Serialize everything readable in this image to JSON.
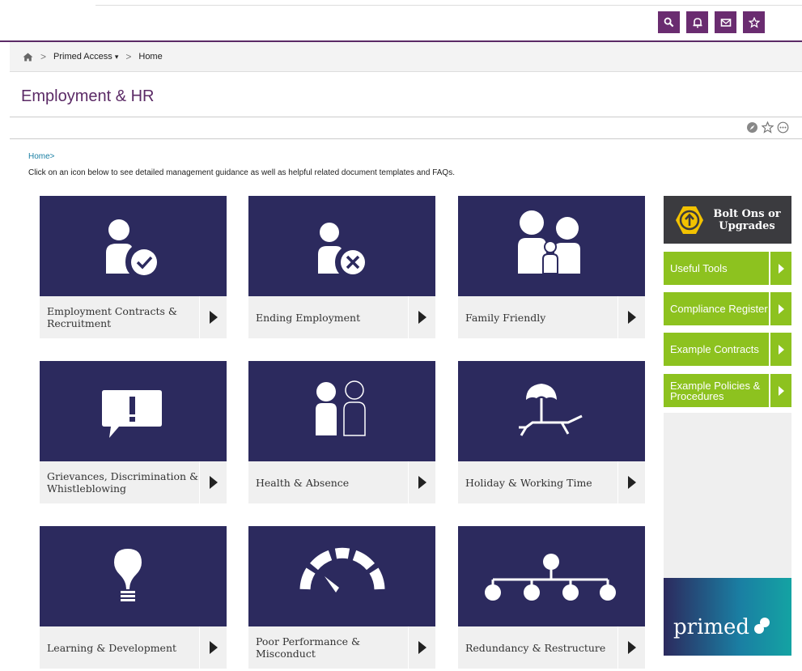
{
  "header": {
    "icons": [
      "search-icon",
      "bell-icon",
      "mail-icon",
      "star-icon"
    ]
  },
  "breadcrumb": {
    "home_icon": "home-icon",
    "items": [
      "Primed Access",
      "Home"
    ],
    "dropdown_caret": "▾",
    "separator": ">"
  },
  "page": {
    "title": "Employment & HR",
    "toolbar_icons": [
      "compass-icon",
      "star-outline-icon",
      "more-icon"
    ],
    "home_link": "Home>",
    "intro": "Click on an icon below to see detailed management guidance as well as helpful related document templates and FAQs."
  },
  "tiles": [
    {
      "label": "Employment Contracts & Recruitment",
      "icon": "person-check-icon"
    },
    {
      "label": "Ending Employment",
      "icon": "person-cross-icon"
    },
    {
      "label": "Family Friendly",
      "icon": "family-icon"
    },
    {
      "label": "Grievances, Discrimination & Whistleblowing",
      "icon": "speech-alert-icon"
    },
    {
      "label": "Health & Absence",
      "icon": "people-absence-icon"
    },
    {
      "label": "Holiday & Working Time",
      "icon": "beach-umbrella-icon"
    },
    {
      "label": "Learning & Development",
      "icon": "lightbulb-icon"
    },
    {
      "label": "Poor Performance & Misconduct",
      "icon": "gauge-icon"
    },
    {
      "label": "Redundancy & Restructure",
      "icon": "org-chart-icon"
    }
  ],
  "sidebar": {
    "bolt_label": "Bolt Ons or Upgrades",
    "links": [
      {
        "label": "Useful Tools"
      },
      {
        "label": "Compliance Register"
      },
      {
        "label": "Example Contracts"
      },
      {
        "label": "Example Policies & Procedures"
      }
    ],
    "logo_text": "primed"
  },
  "colors": {
    "brand_purple": "#6a2c70",
    "tile_navy": "#2c2a5e",
    "accent_green": "#8dc21f",
    "link_blue": "#1a7fa3"
  }
}
